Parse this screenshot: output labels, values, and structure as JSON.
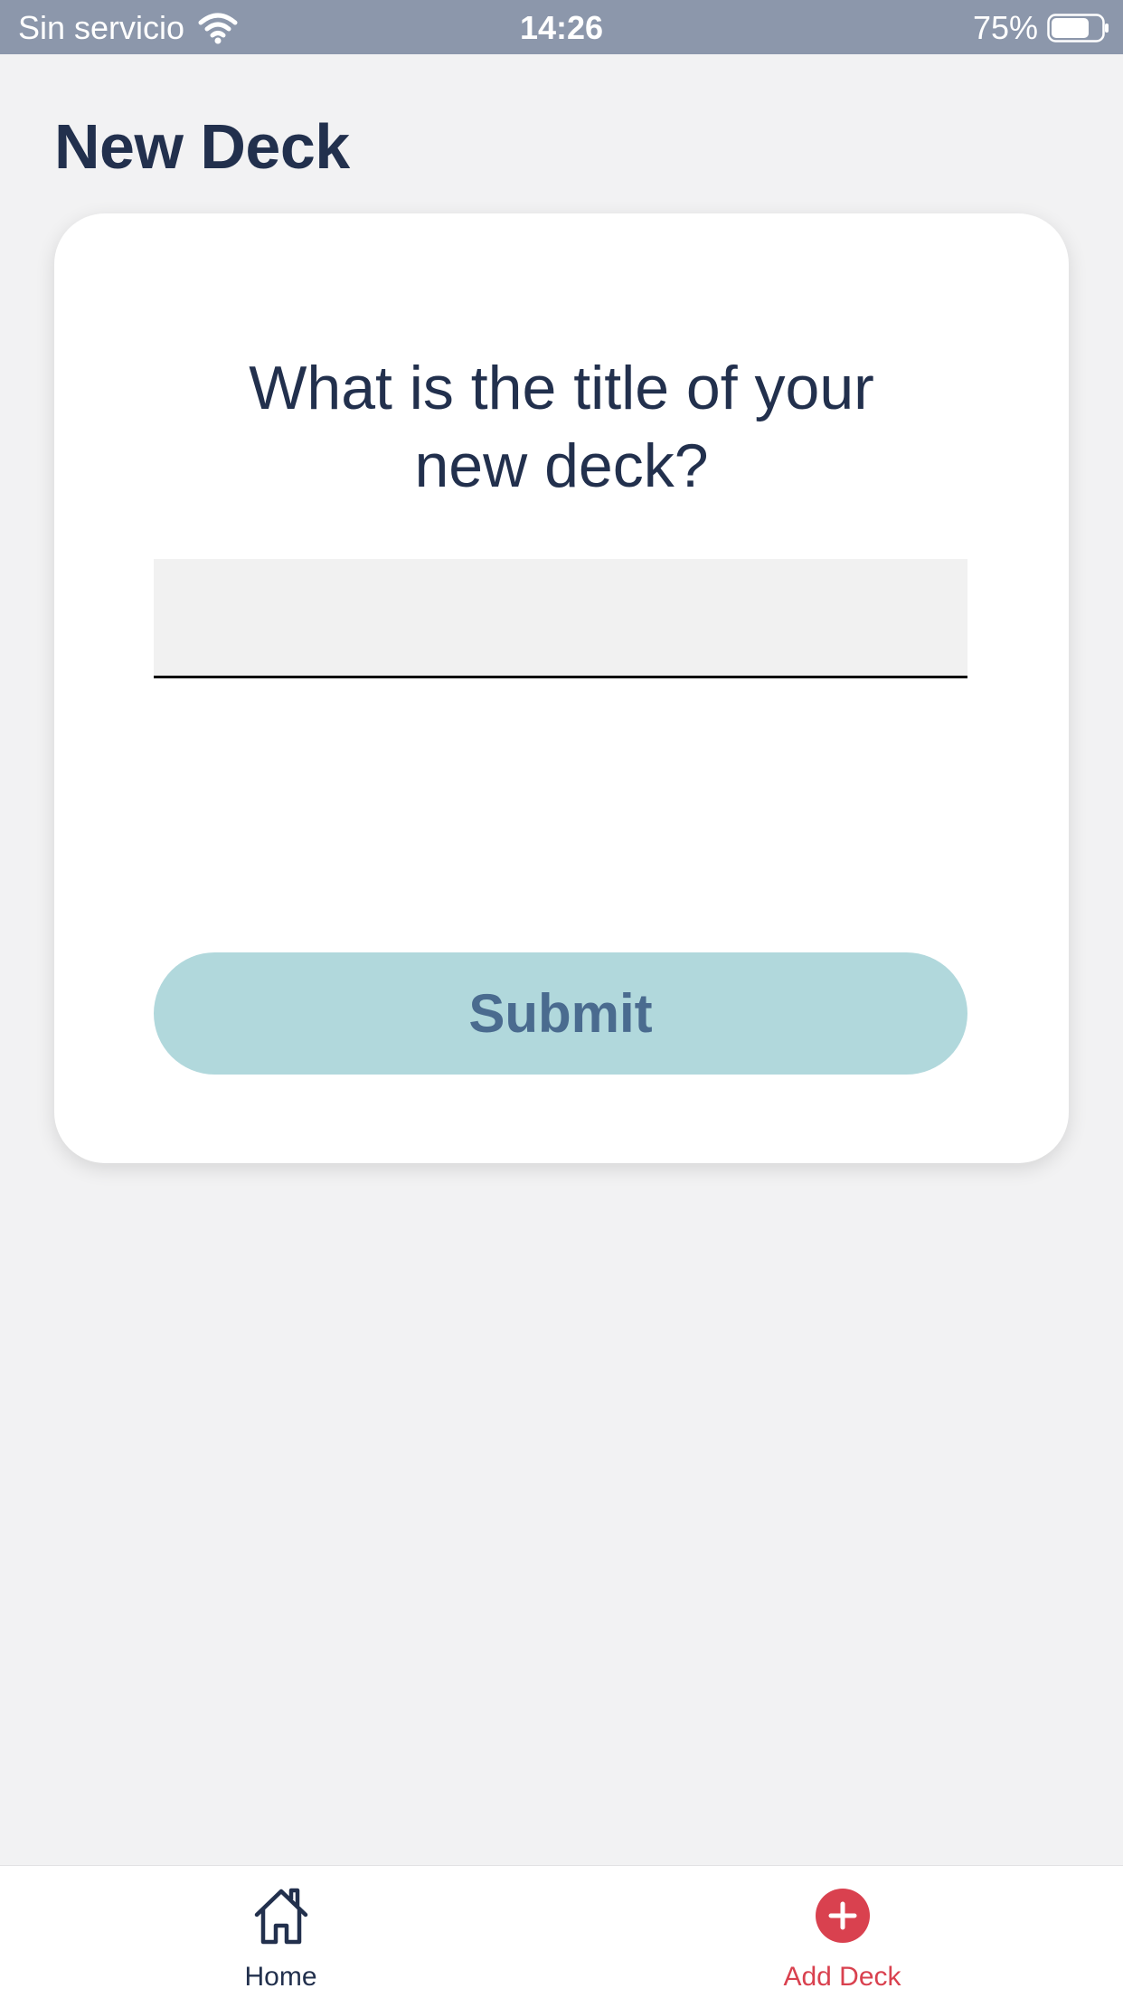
{
  "status_bar": {
    "carrier": "Sin servicio",
    "time": "14:26",
    "battery": "75%",
    "battery_level": 0.75
  },
  "header": {
    "title": "New Deck"
  },
  "form": {
    "question": "What is the title of your new deck?",
    "input_value": "",
    "input_placeholder": "",
    "submit_label": "Submit"
  },
  "tab_bar": {
    "items": [
      {
        "label": "Home",
        "icon": "home-icon",
        "active": false
      },
      {
        "label": "Add Deck",
        "icon": "plus-circle-icon",
        "active": true
      }
    ]
  },
  "colors": {
    "status_bar_bg": "#8c97ab",
    "title_text": "#22304d",
    "submit_bg": "#b1d8dc",
    "submit_text": "#4a6b8f",
    "active_tab": "#d9414f"
  }
}
